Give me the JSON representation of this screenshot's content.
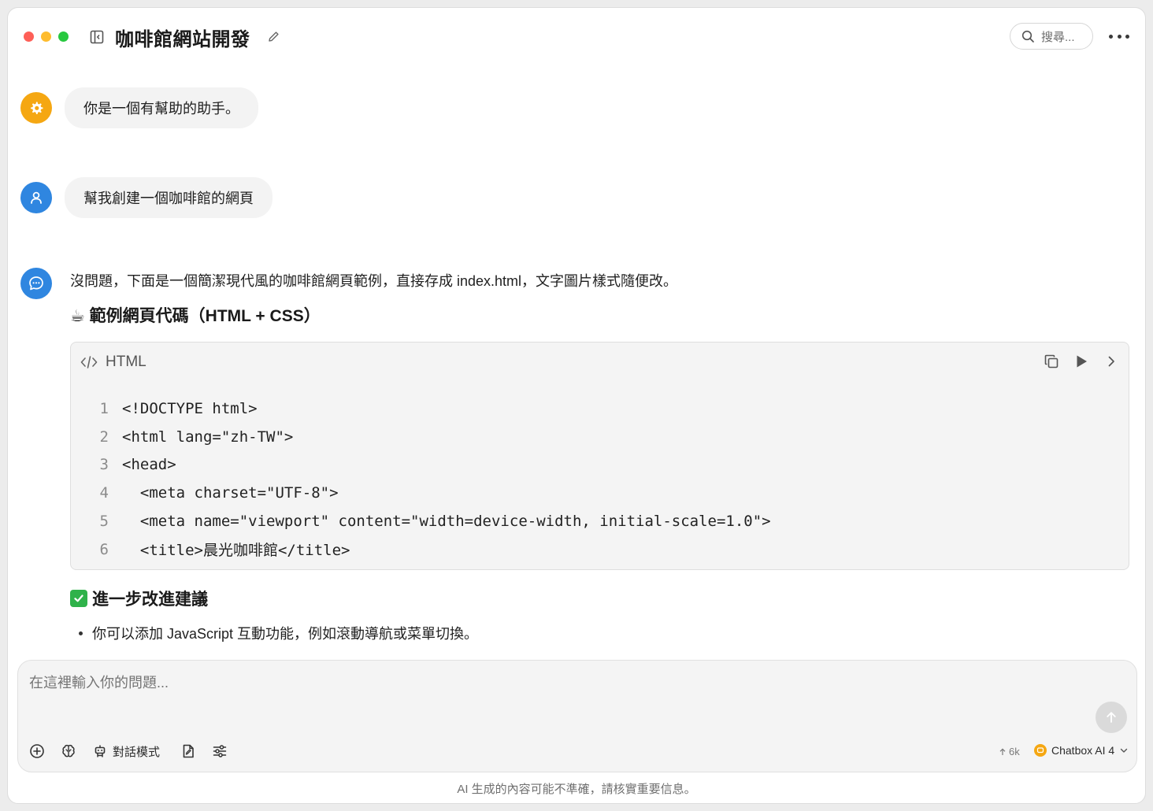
{
  "header": {
    "title": "咖啡館網站開發",
    "search_label": "搜尋..."
  },
  "messages": {
    "system": "你是一個有幫助的助手。",
    "user": "幫我創建一個咖啡館的網頁",
    "assistant_intro": "沒問題，下面是一個簡潔現代風的咖啡館網頁範例，直接存成 index.html，文字圖片樣式隨便改。",
    "example_heading": "☕ 範例網頁代碼（HTML + CSS）",
    "code_block": {
      "language": "HTML",
      "lines": [
        {
          "n": "1",
          "text": "<!DOCTYPE html>"
        },
        {
          "n": "2",
          "text": "<html lang=\"zh-TW\">"
        },
        {
          "n": "3",
          "text": "<head>"
        },
        {
          "n": "4",
          "text": "  <meta charset=\"UTF-8\">"
        },
        {
          "n": "5",
          "text": "  <meta name=\"viewport\" content=\"width=device-width, initial-scale=1.0\">"
        },
        {
          "n": "6",
          "text": "  <title>晨光咖啡館</title>"
        }
      ]
    },
    "improve_heading": "進一步改進建議",
    "improve_items": [
      "你可以添加 JavaScript 互動功能，例如滾動導航或菜單切換。"
    ]
  },
  "composer": {
    "placeholder": "在這裡輸入你的問題...",
    "mode_label": "對話模式",
    "token_count": "6k",
    "model_name": "Chatbox AI 4"
  },
  "footer": {
    "disclaimer": "AI 生成的內容可能不準確，請核實重要信息。"
  },
  "colors": {
    "system_avatar": "#f5a712",
    "user_avatar": "#2f86e0",
    "assistant_avatar": "#2f86e0",
    "check_green": "#2fb24a"
  },
  "icons": [
    "sidebar-toggle-icon",
    "edit-icon",
    "search-icon",
    "more-icon",
    "gear-icon",
    "user-icon",
    "chat-bubble-icon",
    "code-icon",
    "copy-icon",
    "play-icon",
    "chevron-right-icon",
    "check-icon",
    "plus-circle-icon",
    "brain-icon",
    "robot-icon",
    "document-icon",
    "sliders-icon",
    "arrow-up-icon",
    "chevron-down-icon"
  ]
}
